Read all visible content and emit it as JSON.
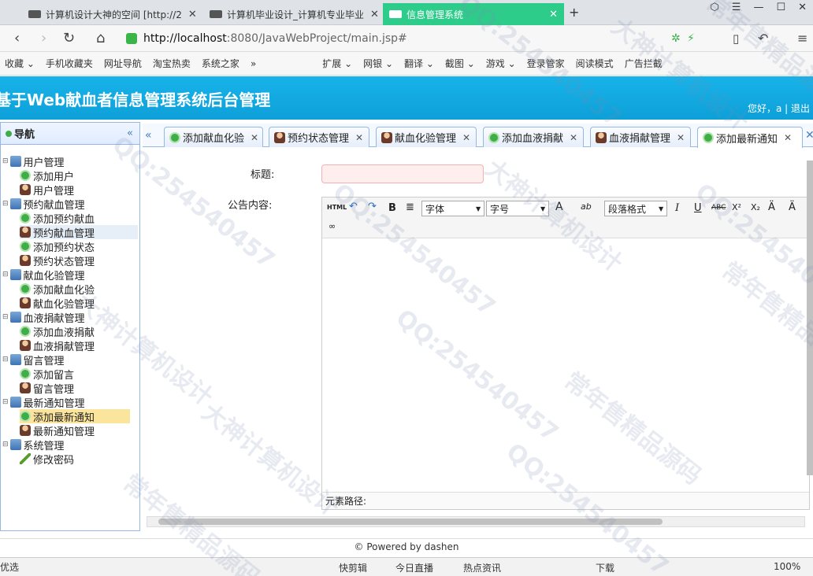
{
  "browser": {
    "tabs": [
      {
        "title": "计算机设计大神的空间 [http://2"
      },
      {
        "title": "计算机毕业设计_计算机专业毕业"
      },
      {
        "title": "信息管理系统"
      }
    ],
    "new_tab": "+",
    "url_host": "http://localhost",
    "url_rest": ":8080/JavaWebProject/main.jsp#",
    "bookmarks": [
      "收藏 ⌄",
      "手机收藏夹",
      "网址导航",
      "淘宝热卖",
      "系统之家",
      "»",
      "扩展 ⌄",
      "网银 ⌄",
      "翻译 ⌄",
      "截图 ⌄",
      "游戏 ⌄",
      "登录管家",
      "阅读模式",
      "广告拦截"
    ]
  },
  "app": {
    "title": "基于Web献血者信息管理系统后台管理",
    "greeting": "您好，a | 退出"
  },
  "nav": {
    "header": "导航",
    "collapse": "«",
    "groups": [
      {
        "label": "用户管理",
        "items": [
          {
            "label": "添加用户",
            "icon": "add"
          },
          {
            "label": "用户管理",
            "icon": "user"
          }
        ]
      },
      {
        "label": "预约献血管理",
        "items": [
          {
            "label": "添加预约献血",
            "icon": "add"
          },
          {
            "label": "预约献血管理",
            "icon": "user"
          },
          {
            "label": "添加预约状态",
            "icon": "add"
          },
          {
            "label": "预约状态管理",
            "icon": "user"
          }
        ]
      },
      {
        "label": "献血化验管理",
        "items": [
          {
            "label": "添加献血化验",
            "icon": "add"
          },
          {
            "label": "献血化验管理",
            "icon": "user"
          }
        ]
      },
      {
        "label": "血液捐献管理",
        "items": [
          {
            "label": "添加血液捐献",
            "icon": "add"
          },
          {
            "label": "血液捐献管理",
            "icon": "user"
          }
        ]
      },
      {
        "label": "留言管理",
        "items": [
          {
            "label": "添加留言",
            "icon": "add"
          },
          {
            "label": "留言管理",
            "icon": "user"
          }
        ]
      },
      {
        "label": "最新通知管理",
        "items": [
          {
            "label": "添加最新通知",
            "icon": "add"
          },
          {
            "label": "最新通知管理",
            "icon": "user"
          }
        ]
      },
      {
        "label": "系统管理",
        "items": [
          {
            "label": "修改密码",
            "icon": "pen"
          }
        ]
      }
    ],
    "selected": "添加最新通知"
  },
  "content_tabs": [
    {
      "label": "添加献血化验",
      "icon": "add"
    },
    {
      "label": "预约状态管理",
      "icon": "user"
    },
    {
      "label": "献血化验管理",
      "icon": "user"
    },
    {
      "label": "添加血液捐献",
      "icon": "add"
    },
    {
      "label": "血液捐献管理",
      "icon": "user"
    },
    {
      "label": "添加最新通知",
      "icon": "add",
      "active": true
    }
  ],
  "form": {
    "title_label": "标题:",
    "title_value": "",
    "content_label": "公告内容:",
    "toolbar": {
      "html": "HTML",
      "bold": "B",
      "font": "字体",
      "size": "字号",
      "paragraph": "段落格式",
      "italic": "I",
      "underline": "U",
      "strike": "ABC",
      "sup": "X²",
      "sub": "X₂",
      "fontcolor": "A",
      "highlight": "ab"
    },
    "element_path": "元素路径:"
  },
  "footer": "© Powered by dashen",
  "statusbar": {
    "left": "优选",
    "items": [
      "快剪辑",
      "今日直播",
      "热点资讯",
      "下载",
      "100%"
    ]
  },
  "watermark": [
    "QQ:254540457",
    "大神计算机设计",
    "常年售精品源码"
  ]
}
